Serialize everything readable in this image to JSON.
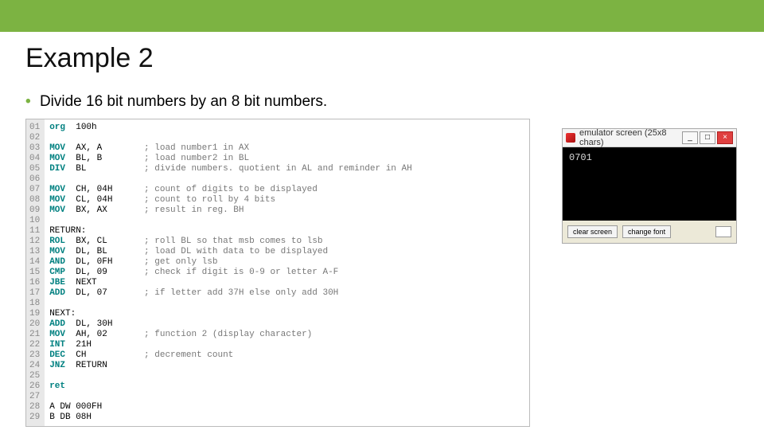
{
  "slide": {
    "title": "Example 2",
    "bullet": "Divide 16 bit numbers by an 8 bit numbers."
  },
  "code": {
    "lines": [
      {
        "n": "01",
        "kw": "org",
        "args": "100h",
        "cmt": ""
      },
      {
        "n": "02",
        "kw": "",
        "args": "",
        "cmt": ""
      },
      {
        "n": "03",
        "kw": "MOV",
        "args": "AX, A",
        "cmt": "; load number1 in AX"
      },
      {
        "n": "04",
        "kw": "MOV",
        "args": "BL, B",
        "cmt": "; load number2 in BL"
      },
      {
        "n": "05",
        "kw": "DIV",
        "args": "BL",
        "cmt": "; divide numbers. quotient in AL and reminder in AH"
      },
      {
        "n": "06",
        "kw": "",
        "args": "",
        "cmt": ""
      },
      {
        "n": "07",
        "kw": "MOV",
        "args": "CH, 04H",
        "cmt": "; count of digits to be displayed"
      },
      {
        "n": "08",
        "kw": "MOV",
        "args": "CL, 04H",
        "cmt": "; count to roll by 4 bits"
      },
      {
        "n": "09",
        "kw": "MOV",
        "args": "BX, AX",
        "cmt": "; result in reg. BH"
      },
      {
        "n": "10",
        "kw": "",
        "args": "",
        "cmt": ""
      },
      {
        "n": "11",
        "kw": "",
        "label": "RETURN:",
        "args": "",
        "cmt": ""
      },
      {
        "n": "12",
        "kw": "ROL",
        "args": "BX, CL",
        "cmt": "; roll BL so that msb comes to lsb"
      },
      {
        "n": "13",
        "kw": "MOV",
        "args": "DL, BL",
        "cmt": "; load DL with data to be displayed"
      },
      {
        "n": "14",
        "kw": "AND",
        "args": "DL, 0FH",
        "cmt": "; get only lsb"
      },
      {
        "n": "15",
        "kw": "CMP",
        "args": "DL, 09",
        "cmt": "; check if digit is 0-9 or letter A-F"
      },
      {
        "n": "16",
        "kw": "JBE",
        "args": "NEXT",
        "cmt": ""
      },
      {
        "n": "17",
        "kw": "ADD",
        "args": "DL, 07",
        "cmt": "; if letter add 37H else only add 30H"
      },
      {
        "n": "18",
        "kw": "",
        "args": "",
        "cmt": ""
      },
      {
        "n": "19",
        "kw": "",
        "label": "NEXT:",
        "args": "",
        "cmt": ""
      },
      {
        "n": "20",
        "kw": "ADD",
        "args": "DL, 30H",
        "cmt": ""
      },
      {
        "n": "21",
        "kw": "MOV",
        "args": "AH, 02",
        "cmt": "; function 2 (display character)"
      },
      {
        "n": "22",
        "kw": "INT",
        "args": "21H",
        "cmt": ""
      },
      {
        "n": "23",
        "kw": "DEC",
        "args": "CH",
        "cmt": "; decrement count"
      },
      {
        "n": "24",
        "kw": "JNZ",
        "args": "RETURN",
        "cmt": ""
      },
      {
        "n": "25",
        "kw": "",
        "args": "",
        "cmt": ""
      },
      {
        "n": "26",
        "kw": "ret",
        "args": "",
        "cmt": ""
      },
      {
        "n": "27",
        "kw": "",
        "args": "",
        "cmt": ""
      },
      {
        "n": "28",
        "kw": "",
        "label": "A DW 000FH",
        "args": "",
        "cmt": ""
      },
      {
        "n": "29",
        "kw": "",
        "label": "B DB 08H",
        "args": "",
        "cmt": ""
      }
    ]
  },
  "emulator": {
    "title": "emulator screen (25x8 chars)",
    "output": "0701",
    "btn_clear": "clear screen",
    "btn_font": "change font"
  }
}
